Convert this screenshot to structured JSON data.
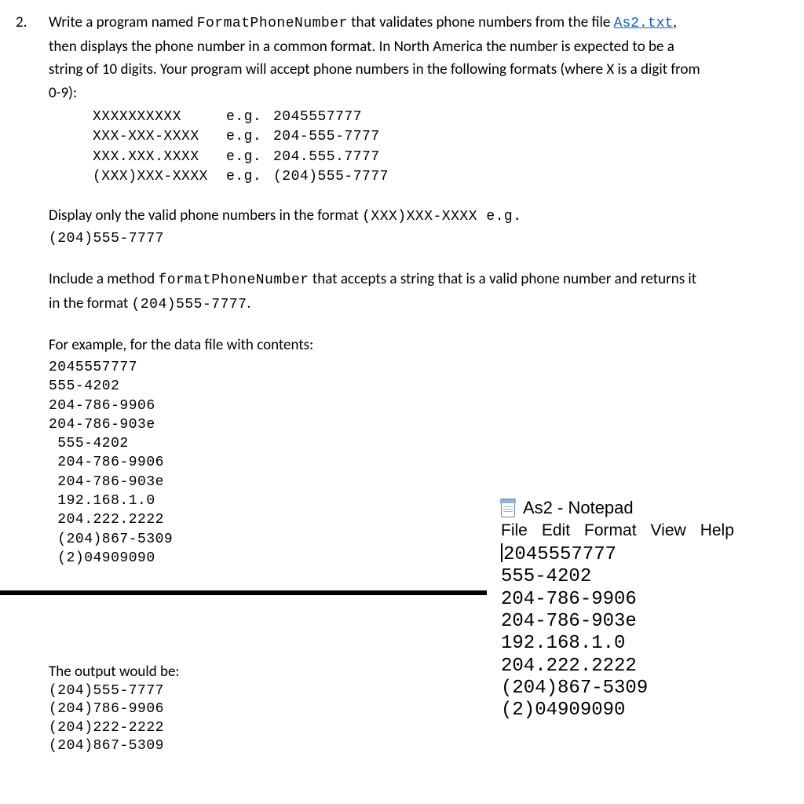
{
  "question": {
    "number": "2.",
    "intro_prefix": "Write a program named ",
    "program_name": "FormatPhoneNumber",
    "intro_mid": " that validates phone numbers from the file ",
    "file_link": "As2.txt",
    "intro_after_link": ", then displays the phone number in a common format.  In North America the number is expected to be a string of 10 digits.  Your program will accept phone numbers in the following formats (where X is a digit from 0-9):",
    "formats": [
      {
        "pattern": "XXXXXXXXXX",
        "eg": "e.g.",
        "example": "2045557777"
      },
      {
        "pattern": "XXX-XXX-XXXX",
        "eg": "e.g.",
        "example": "204-555-7777"
      },
      {
        "pattern": "XXX.XXX.XXXX",
        "eg": "e.g.",
        "example": "204.555.7777"
      },
      {
        "pattern": "(XXX)XXX-XXXX",
        "eg": "e.g.",
        "example": "(204)555-7777"
      }
    ],
    "display_rule_prefix": "Display only the valid phone numbers in the format ",
    "display_rule_mono1": "(XXX)XXX-XXXX e.g.",
    "display_rule_mono2": "(204)555-7777",
    "method_prefix": "Include a method ",
    "method_name": "formatPhoneNumber",
    "method_mid": " that accepts a string that is a valid phone number and returns it in the format ",
    "method_example": "(204)555-7777",
    "method_suffix": ".",
    "example_intro": "For example, for the data file with contents:",
    "data_file": [
      "2045557777",
      "555-4202",
      "204-786-9906",
      "204-786-903e",
      " 555-4202",
      " 204-786-9906",
      " 204-786-903e",
      " 192.168.1.0",
      " 204.222.2222",
      " (204)867-5309",
      " (2)04909090"
    ],
    "output_label": "The output would be:",
    "output_lines": [
      "(204)555-7777",
      "(204)786-9906",
      "(204)222-2222",
      "(204)867-5309"
    ]
  },
  "notepad": {
    "title": "As2 - Notepad",
    "menu": [
      "File",
      "Edit",
      "Format",
      "View",
      "Help"
    ],
    "body": [
      "2045557777",
      "555-4202",
      "204-786-9906",
      "204-786-903e",
      "192.168.1.0",
      "204.222.2222",
      "(204)867-5309",
      "(2)04909090"
    ]
  }
}
